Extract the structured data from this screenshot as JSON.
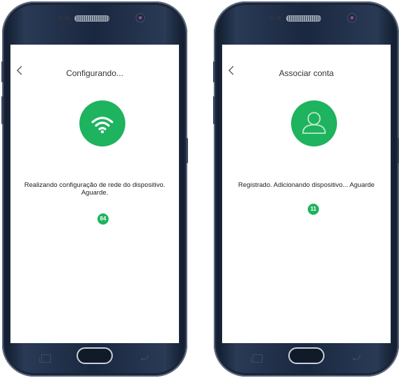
{
  "screens": [
    {
      "title": "Configurando...",
      "message": "Realizando configuração de rede do dispositivo. Aguarde.",
      "countdown": "84",
      "icon": "wifi-icon",
      "accent": "#1eb35e"
    },
    {
      "title": "Associar conta",
      "message": "Registrado. Adicionando dispositivo... Aguarde",
      "countdown": "11",
      "icon": "user-icon",
      "accent": "#1eb35e"
    }
  ],
  "icons": {
    "back": "chevron-left-icon",
    "recent_apps": "recent-apps-icon",
    "home": "home-button",
    "nav_back": "back-arrow-icon"
  }
}
